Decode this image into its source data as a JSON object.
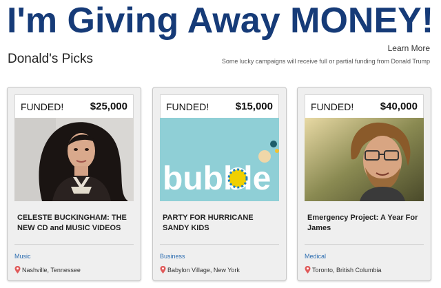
{
  "header": {
    "title": "I'm Giving Away MONEY!",
    "subtitle": "Donald's Picks",
    "learn_more": "Learn More",
    "tagline": "Some lucky campaigns will receive full or partial funding from Donald Trump"
  },
  "cards": [
    {
      "status": "FUNDED!",
      "amount": "$25,000",
      "title": "CELESTE BUCKINGHAM: THE NEW CD and MUSIC VIDEOS",
      "category": "Music",
      "location": "Nashville, Tennessee",
      "image": "portrait-woman-dark-hair"
    },
    {
      "status": "FUNDED!",
      "amount": "$15,000",
      "title": "PARTY FOR HURRICANE SANDY KIDS",
      "category": "Business",
      "location": "Babylon Village, New York",
      "image": "bubble-logo",
      "image_text": "bubble"
    },
    {
      "status": "FUNDED!",
      "amount": "$40,000",
      "title": "Emergency Project: A Year For James",
      "category": "Medical",
      "location": "Toronto, British Columbia",
      "image": "portrait-man-glasses"
    }
  ],
  "colors": {
    "headline": "#163b78",
    "link": "#2b6cb0",
    "pin": "#e05a5a",
    "card_bg": "#efefef"
  },
  "icons": {
    "location": "map-pin-icon"
  }
}
